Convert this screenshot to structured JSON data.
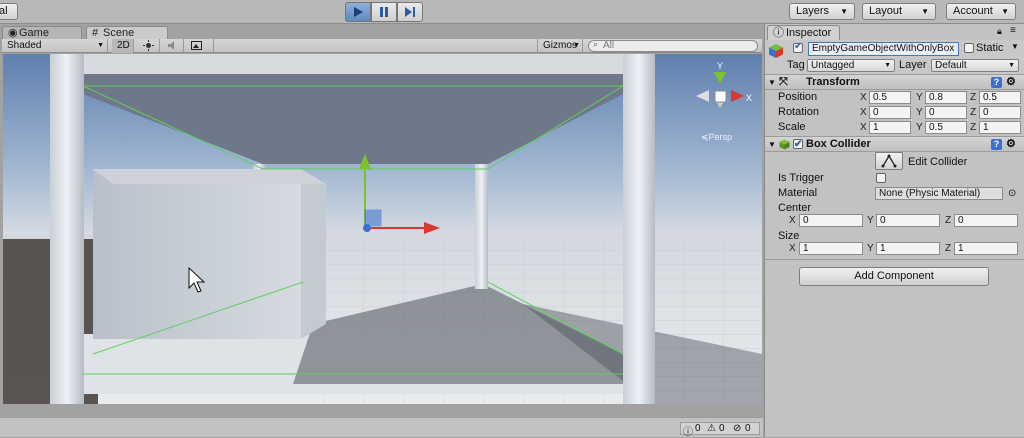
{
  "toolbar": {
    "left_stub": "al",
    "layers": "Layers",
    "layout": "Layout",
    "account": "Account"
  },
  "tabs": {
    "game": "Game",
    "scene": "Scene"
  },
  "scene_bar": {
    "shading": "Shaded",
    "mode_2d": "2D",
    "gizmos": "Gizmos",
    "search_placeholder": "All",
    "persp": "≼Persp"
  },
  "status": {
    "info_count": "0",
    "warn_count": "0",
    "error_count": "0"
  },
  "inspector": {
    "tab": "Inspector",
    "object_name": "EmptyGameObjectWithOnlyBox",
    "static_label": "Static",
    "tag_label": "Tag",
    "tag_value": "Untagged",
    "layer_label": "Layer",
    "layer_value": "Default",
    "transform": {
      "title": "Transform",
      "position_label": "Position",
      "rotation_label": "Rotation",
      "scale_label": "Scale",
      "position": {
        "x": "0.5",
        "y": "0.8",
        "z": "0.5"
      },
      "rotation": {
        "x": "0",
        "y": "0",
        "z": "0"
      },
      "scale": {
        "x": "1",
        "y": "0.5",
        "z": "1"
      }
    },
    "box_collider": {
      "title": "Box Collider",
      "edit_collider": "Edit Collider",
      "is_trigger_label": "Is Trigger",
      "material_label": "Material",
      "material_value": "None (Physic Material)",
      "center_label": "Center",
      "size_label": "Size",
      "center": {
        "x": "0",
        "y": "0",
        "z": "0"
      },
      "size": {
        "x": "1",
        "y": "1",
        "z": "1"
      }
    },
    "add_component": "Add Component"
  },
  "axis_letters": {
    "x": "X",
    "y": "Y",
    "z": "Z"
  },
  "colors": {
    "play_active": "#5f88bf",
    "gizmo_x": "#d8382e",
    "gizmo_y": "#7cc22a",
    "gizmo_z": "#3b6fd0",
    "collider_outline": "#5fd05f"
  },
  "icons": [
    "play-icon",
    "pause-icon",
    "step-icon",
    "sun-icon",
    "speaker-icon",
    "image-icon",
    "search-icon",
    "lock-icon",
    "menu-icon",
    "gameobject-cube-icon",
    "transform-icon",
    "help-icon",
    "gear-icon",
    "collider-icon",
    "edit-collider-icon",
    "object-picker-icon",
    "info-icon",
    "warning-icon",
    "error-icon",
    "cursor-icon"
  ]
}
